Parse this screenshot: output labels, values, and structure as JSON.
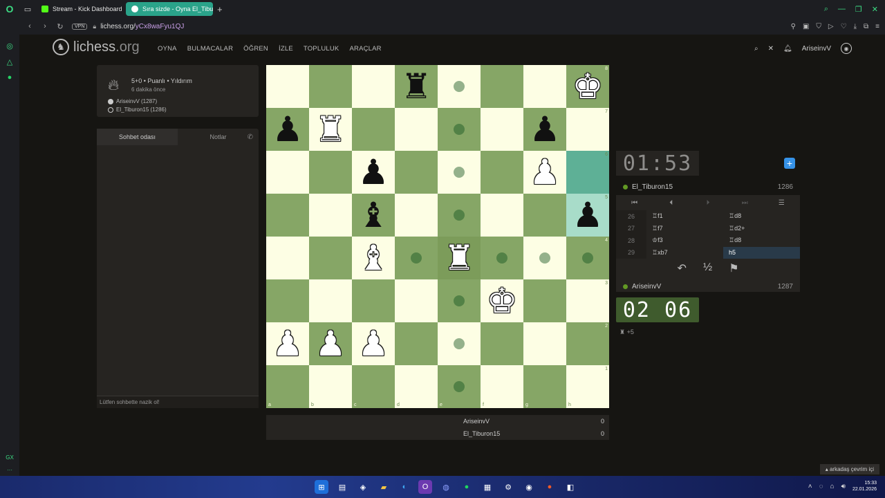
{
  "browser": {
    "tabs": [
      {
        "label": "Stream - Kick Dashboard",
        "color": "#53fc18",
        "active": false
      },
      {
        "label": "Sıra sizde - Oyna El_Tiburon",
        "color": "#ffffff",
        "active": true
      }
    ],
    "url_host": "lichess.org/",
    "url_path": "yCx8waFyu1QJ",
    "vpn": "VPN"
  },
  "site": {
    "logo": "lichess",
    "logo_suffix": ".org",
    "nav": [
      "OYNA",
      "BULMACALAR",
      "ÖĞREN",
      "İZLE",
      "TOPLULUK",
      "ARAÇLAR"
    ],
    "username": "AriseinvV"
  },
  "game": {
    "title": "5+0 • Puanlı • Yıldırım",
    "time_ago": "6 dakika önce",
    "white_player": "AriseinvV (1287)",
    "black_player": "El_Tiburon15 (1286)"
  },
  "chat": {
    "tab_chat": "Sohbet odası",
    "tab_notes": "Notlar",
    "placeholder": "Lütfen sohbette nazik ol!"
  },
  "board": {
    "files": [
      "a",
      "b",
      "c",
      "d",
      "e",
      "f",
      "g",
      "h"
    ],
    "ranks": [
      "8",
      "7",
      "6",
      "5",
      "4",
      "3",
      "2",
      "1"
    ]
  },
  "score": [
    {
      "name": "AriseinvV",
      "value": "0"
    },
    {
      "name": "El_Tiburon15",
      "value": "0"
    }
  ],
  "opponent": {
    "clock": "01:53",
    "name": "El_Tiburon15",
    "rating": "1286"
  },
  "me": {
    "clock": "02 06",
    "name": "AriseinvV",
    "rating": "1287"
  },
  "moves": [
    {
      "n": "26",
      "w": "♖f1",
      "b": "♖d8"
    },
    {
      "n": "27",
      "w": "♖f7",
      "b": "♖d2+"
    },
    {
      "n": "28",
      "w": "♔f3",
      "b": "♖d8"
    },
    {
      "n": "29",
      "w": "♖xb7",
      "b": "h5"
    }
  ],
  "material": "+5",
  "draw_symbol": "½",
  "chat_badge": "arkadaş çevrim içi",
  "os": {
    "time": "15:33",
    "date": "22.01.2026"
  }
}
